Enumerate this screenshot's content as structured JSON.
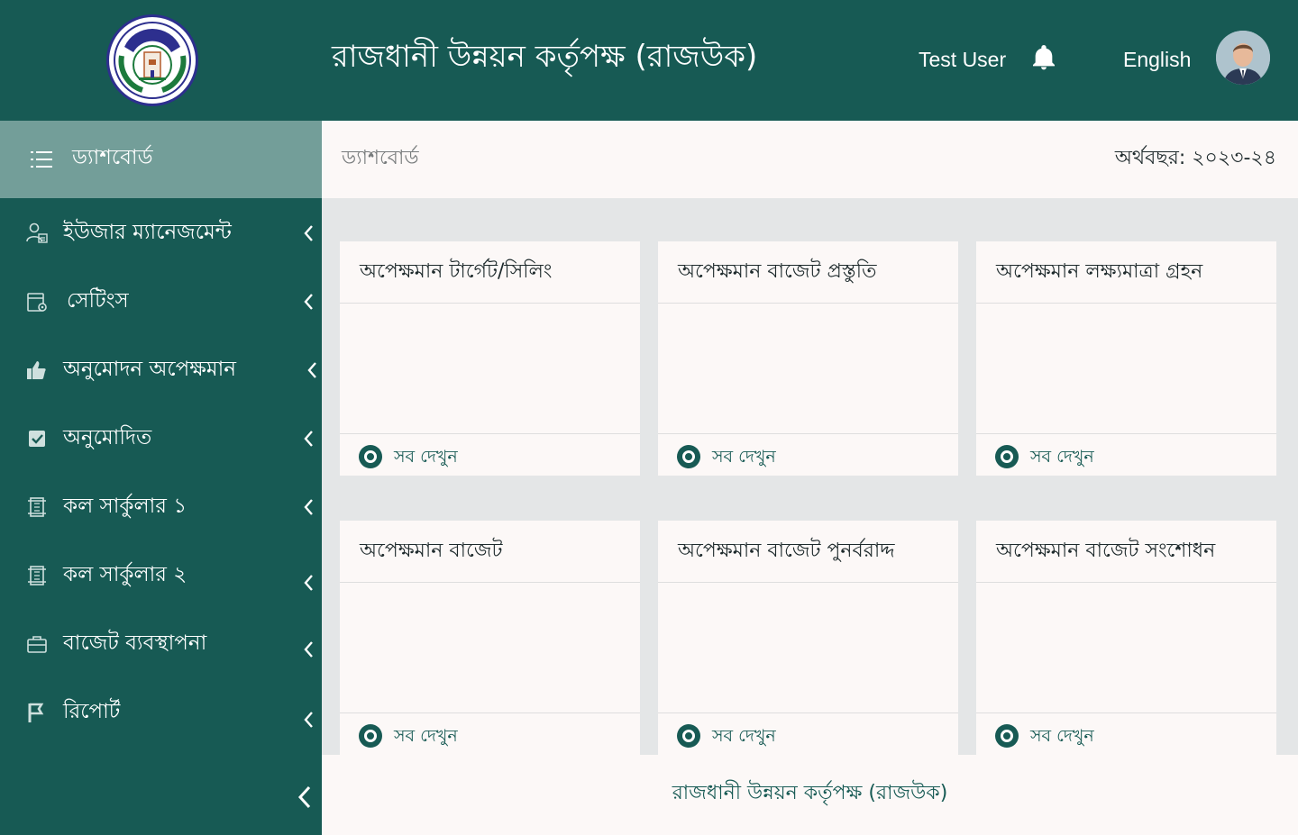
{
  "header": {
    "title": "রাজধানী উন্নয়ন কর্তৃপক্ষ (রাজউক)",
    "user_name": "Test User",
    "language": "English",
    "logo_icon": "rajuk-seal-logo",
    "notification_icon": "bell-icon",
    "avatar_icon": "user-avatar"
  },
  "sidebar": {
    "dashboard_label": "ড্যাশবোর্ড",
    "items": [
      {
        "label": "ইউজার ম্যানেজমেন্ট",
        "icon": "users-icon"
      },
      {
        "label": "সেটিংস",
        "icon": "settings-icon"
      },
      {
        "label": "অনুমোদন অপেক্ষমান",
        "icon": "thumbs-up-icon"
      },
      {
        "label": "অনুমোদিত",
        "icon": "check-square-icon"
      },
      {
        "label": "কল সার্কুলার ১",
        "icon": "circular-icon"
      },
      {
        "label": "কল সার্কুলার ২",
        "icon": "circular-icon"
      },
      {
        "label": "বাজেট ব্যবস্থাপনা",
        "icon": "briefcase-icon"
      },
      {
        "label": "রিপোর্ট",
        "icon": "flag-icon"
      }
    ]
  },
  "subheader": {
    "breadcrumb": "ড্যাশবোর্ড",
    "fiscal_year": "অর্থবছর: ২০২৩-২৪"
  },
  "cards": [
    {
      "title": "অপেক্ষমান টার্গেট/সিলিং",
      "link": "সব দেখুন"
    },
    {
      "title": "অপেক্ষমান বাজেট প্রস্তুতি",
      "link": "সব দেখুন"
    },
    {
      "title": "অপেক্ষমান লক্ষ্যমাত্রা গ্রহন",
      "link": "সব দেখুন"
    },
    {
      "title": "অপেক্ষমান বাজেট",
      "link": "সব দেখুন"
    },
    {
      "title": "অপেক্ষমান বাজেট পুনর্বরাদ্দ",
      "link": "সব দেখুন"
    },
    {
      "title": "অপেক্ষমান বাজেট সংশোধন",
      "link": "সব দেখুন"
    }
  ],
  "footer": {
    "text": "রাজধানী উন্নয়ন কর্তৃপক্ষ (রাজউক)"
  },
  "colors": {
    "primary": "#175a54",
    "active_nav": "#739e99",
    "surface": "#fcf8f7",
    "background": "#e4e6e7"
  }
}
